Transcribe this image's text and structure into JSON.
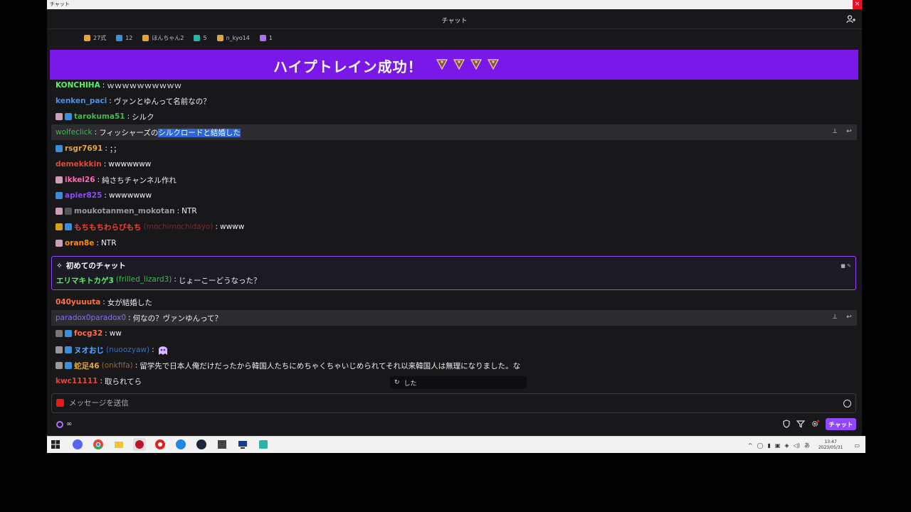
{
  "window": {
    "title": "チャット",
    "close_glyph": "×"
  },
  "header": {
    "title": "チャット"
  },
  "gifts": [
    {
      "name": "27式",
      "color": "#e6a23c"
    },
    {
      "name": "12",
      "color": "#3a8fd8"
    },
    {
      "name": "ほんちゃん2",
      "color": "#e6a23c"
    },
    {
      "name": "5",
      "color": "#2bb3a3"
    },
    {
      "name": "n_kyo14",
      "color": "#e6a23c"
    },
    {
      "name": "1",
      "color": "#a970ff"
    }
  ],
  "hype_train": {
    "label": "ハイプトレイン成功！",
    "accent": "#7a18e8"
  },
  "messages": [
    {
      "user": "KONCHIHA",
      "user_color": "#5cf06a",
      "text": "ｗｗｗｗｗｗｗｗｗｗ"
    },
    {
      "user": "kenken_paci",
      "user_color": "#4a90e2",
      "text": "ヴァンとゆんって名前なの？"
    },
    {
      "user": "tarokuma51",
      "user_color": "#3fb950",
      "text": "シルク"
    },
    {
      "user": "wolfeclick",
      "user_color": "#3fb950",
      "text_before": "フィッシャーズの",
      "text_selected": "シルクロードと結婚した"
    },
    {
      "user": "rsgr7691",
      "user_color": "#e8a33a",
      "text": "；；"
    },
    {
      "user": "demekkkin",
      "user_color": "#e0483a",
      "text": "wwwwwww"
    },
    {
      "user": "ikkei26",
      "user_color": "#ff69b4",
      "text": "純さちチャンネル作れ"
    },
    {
      "user": "apier825",
      "user_color": "#9147ff",
      "text": "wwwwwww"
    },
    {
      "user": "moukotanmen_mokotan",
      "user_color": "#9a9aa2",
      "text": "NTR"
    },
    {
      "user": "もちもちわらびもち",
      "user_sub": "(mochimochidayo)",
      "user_color": "#ff3b30",
      "text": "wwww"
    },
    {
      "user": "oran8e",
      "user_color": "#ff8c00",
      "text": "NTR"
    },
    {
      "user": "040yuuuta",
      "user_color": "#ff7043",
      "text": "女が結婚した"
    },
    {
      "user": "paradox0paradox0",
      "user_color": "#8a6cf0",
      "text": "何なの？ヴァンゆんって？"
    },
    {
      "user": "focg32",
      "user_color": "#ff7043",
      "text": "ww"
    },
    {
      "user": "ヌオおじ",
      "user_sub": "(nuoozyaw)",
      "user_color": "#5aa9ff",
      "text": ""
    },
    {
      "user": "蛇足46",
      "user_sub": "(onkfifa)",
      "user_color": "#e8a33a",
      "text": "留学先で日本人俺だけだったから韓国人たちにめちゃくちゃいじめられてそれ以来韓国人は無理になりました。な"
    },
    {
      "user": "kwc11111",
      "user_color": "#e0483a",
      "text": "取られてら"
    }
  ],
  "first_chat": {
    "title": "初めてのチャット",
    "user": "エリマキトカゲ3",
    "user_sub": "(frilled_lizard3)",
    "user_color": "#5cf06a",
    "text": "じょーこーどうなった？"
  },
  "suggestion": {
    "text": "した"
  },
  "input": {
    "placeholder": "メッセージを送信"
  },
  "footer": {
    "points": "∞",
    "chat_button": "チャット"
  },
  "taskbar": {
    "time": "13:47",
    "date": "2023/05/31",
    "ime": "あ"
  }
}
